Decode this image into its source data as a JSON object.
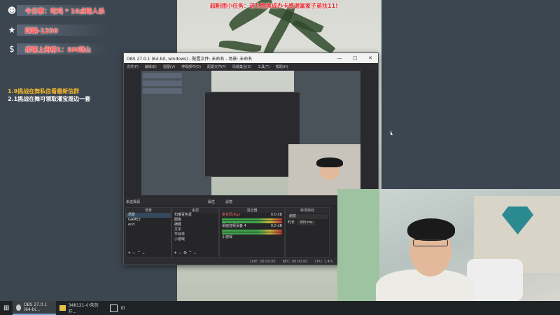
{
  "overlay": {
    "items": [
      {
        "icon": "user-icon",
        "text": "今日事：吃鸡 * 10点陪人杀"
      },
      {
        "icon": "star-icon",
        "text": "踩踏-1350"
      },
      {
        "icon": "dollar-icon",
        "text": "感谢上周榜1：SM胡山"
      }
    ],
    "notes": [
      "1.9挑战在舞私信看最新信群",
      "2.1挑战在舞可领取灌宝周边一套"
    ],
    "banner": "超粉团小任务：送礼物换成办卡感谢富家子弟扶11!"
  },
  "obs": {
    "title": "OBS 27.0.1 (64-bit, windows) - 配置文件: 未命名 - 场景: 未命名",
    "menu": [
      "文件(F)",
      "编辑(E)",
      "视图(V)",
      "停靠部件(D)",
      "配置文件(P)",
      "场景集合(S)",
      "工具(T)",
      "帮助(H)"
    ],
    "no_source": "未选择源",
    "props_btn": "属性",
    "filter_btn": "滤镜",
    "docks": {
      "scenes": {
        "title": "场景",
        "items": [
          "场景",
          "GAME2",
          "end"
        ]
      },
      "sources": {
        "title": "来源",
        "items": [
          "扫描青色素",
          "图像",
          "摘要",
          "文字",
          "节目单",
          "小游戏"
        ]
      },
      "mixer": {
        "title": "混音器",
        "tracks": [
          {
            "name": "麦克风/Aux",
            "level": "0.0 dB"
          },
          {
            "name": "桌面音频设备 4",
            "level": "0.0 dB"
          },
          {
            "name": "小游戏",
            "level": ""
          }
        ]
      },
      "transitions": {
        "title": "转场特效",
        "type": "渐变",
        "duration_label": "时长",
        "duration": "300 ms"
      }
    },
    "status": {
      "live": "LIVE: 00:00:00",
      "rec": "REC: 00:00:00",
      "cpu": "CPU: 1.4%"
    }
  },
  "taskbar": {
    "items": [
      {
        "icon": "windows-icon",
        "label": ""
      },
      {
        "icon": "obs-icon",
        "label": "OBS 27.0.1 (64-bi..."
      },
      {
        "icon": "folder-icon",
        "label": "348121-小朱的开..."
      },
      {
        "icon": "app-icon",
        "label": "iD"
      }
    ]
  }
}
